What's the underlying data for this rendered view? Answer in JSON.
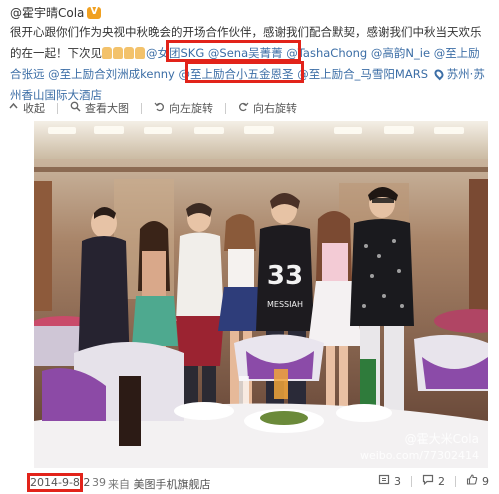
{
  "post": {
    "author": "@霍宇晴Cola",
    "text_lines": [
      [
        {
          "t": "很开心跟你们作为央视中秋晚会的开场合作伙伴，感谢我们配合默契，感谢我们中秋当天欢乐",
          "link": false
        }
      ],
      [
        {
          "t": "的在一起！下次见",
          "link": false
        },
        {
          "t": "@女团SKG",
          "link": true
        },
        {
          "t": " ",
          "link": false
        },
        {
          "t": "@Sena吴菁菁",
          "link": true
        },
        {
          "t": " ",
          "link": false
        },
        {
          "t": "@TashaChong",
          "link": true
        },
        {
          "t": " ",
          "link": false
        },
        {
          "t": "@高韵N_ie",
          "link": true
        },
        {
          "t": " ",
          "link": false
        },
        {
          "t": "@至上励",
          "link": true
        }
      ],
      [
        {
          "t": "合张远",
          "link": true
        },
        {
          "t": " ",
          "link": false
        },
        {
          "t": "@至上励合刘洲成kenny",
          "link": true
        },
        {
          "t": " ",
          "link": false
        },
        {
          "t": "@至上励合小五金恩圣",
          "link": true
        },
        {
          "t": " ",
          "link": false
        },
        {
          "t": "@至上励合_马雪阳MARS",
          "link": true
        },
        {
          "t": " ",
          "link": false
        },
        {
          "t": "苏州·苏",
          "link": true
        }
      ],
      [
        {
          "t": "州香山国际大酒店",
          "link": true
        }
      ]
    ],
    "toolbar": {
      "collapse": "收起",
      "view_large": "查看大图",
      "rotate_left": "向左旋转",
      "rotate_right": "向右旋转"
    },
    "photo": {
      "watermark_name": "@霍大米Cola",
      "watermark_url": "weibo.com/77302414",
      "shirt_number": "33",
      "shirt_text": "MESSIAH"
    },
    "footer": {
      "date": "2014-9-8 2",
      "count": "39",
      "source_prefix": "来自",
      "source_name": "美图手机旗舰店",
      "repost_count": "3",
      "comment_count": "2",
      "like_count": "9"
    }
  },
  "colors": {
    "link": "#3c6ea6",
    "highlight_box": "#e2231a",
    "text": "#333333"
  }
}
